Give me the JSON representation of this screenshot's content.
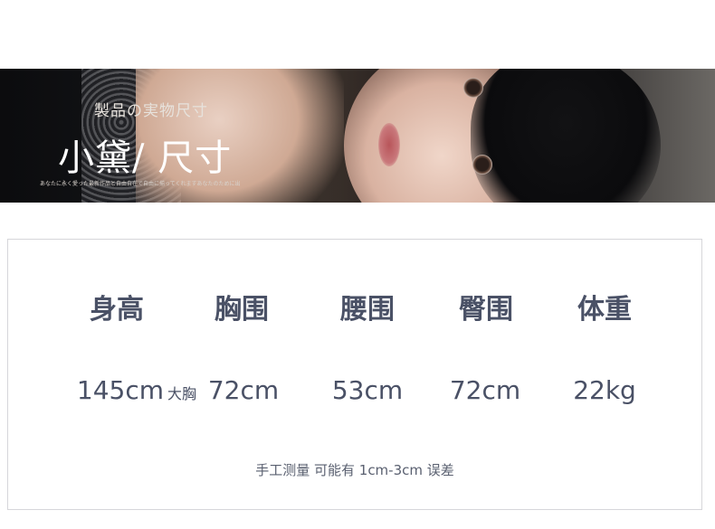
{
  "banner": {
    "subtitle": "製品の実物尺寸",
    "title": "小黛/ 尺寸",
    "tagline": "あなたに永く愛った最新作品と自由自在で自由に揃ってくれますあなたのために出"
  },
  "specs": {
    "columns": [
      {
        "label": "身高",
        "value": "145cm",
        "note": "大胸"
      },
      {
        "label": "胸围",
        "value": "72cm",
        "note": ""
      },
      {
        "label": "腰围",
        "value": "53cm",
        "note": ""
      },
      {
        "label": "臀围",
        "value": "72cm",
        "note": ""
      },
      {
        "label": "体重",
        "value": "22kg",
        "note": ""
      }
    ],
    "footnote": "手工测量 可能有 1cm-3cm 误差"
  },
  "colors": {
    "text": "#4a5166",
    "border": "#d6d6da",
    "banner_dark": "#15171a"
  }
}
